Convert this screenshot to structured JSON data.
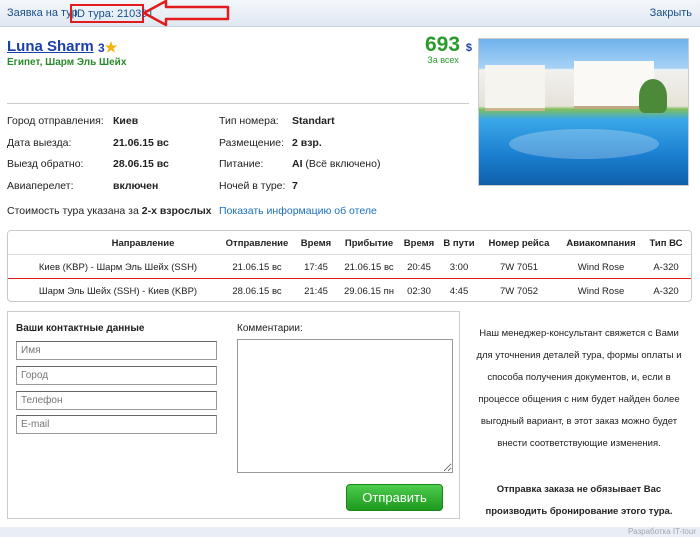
{
  "topbar": {
    "request_label": "Заявка на тур",
    "tour_id_label": "ID тура: 210391",
    "close_label": "Закрыть"
  },
  "hotel": {
    "name": "Luna Sharm",
    "stars": "3",
    "location": "Египет, Шарм Эль Шейх",
    "price": "693",
    "currency": "$",
    "price_note": "За всех",
    "photo_icon": "hotel-photo"
  },
  "details": {
    "departure_city_label": "Город отправления:",
    "departure_city": "Киев",
    "departure_date_label": "Дата выезда:",
    "departure_date": "21.06.15 вс",
    "return_date_label": "Выезд обратно:",
    "return_date": "28.06.15 вс",
    "flight_label": "Авиаперелет:",
    "flight": "включен",
    "room_type_label": "Тип номера:",
    "room_type": "Standart",
    "placement_label": "Размещение:",
    "placement": "2 взр.",
    "meals_label": "Питание:",
    "meals_code": "AI",
    "meals_desc": "(Всё включено)",
    "nights_label": "Ночей в туре:",
    "nights": "7"
  },
  "note": {
    "text": "Стоимость тура указана за",
    "bold": "2-х взрослых",
    "hotel_link": "Показать информацию об отеле"
  },
  "flights": {
    "headers": [
      "Направление",
      "Отправление",
      "Время",
      "Прибытие",
      "Время",
      "В пути",
      "Номер рейса",
      "Авиакомпания",
      "Тип ВС"
    ],
    "rows": [
      [
        "Киев (KBP) - Шарм Эль Шейх (SSH)",
        "21.06.15 вс",
        "17:45",
        "21.06.15 вс",
        "20:45",
        "3:00",
        "7W 7051",
        "Wind Rose",
        "A-320"
      ],
      [
        "Шарм Эль Шейх (SSH) - Киев (KBP)",
        "28.06.15 вс",
        "21:45",
        "29.06.15 пн",
        "02:30",
        "4:45",
        "7W 7052",
        "Wind Rose",
        "A-320"
      ]
    ]
  },
  "contact": {
    "title": "Ваши контактные данные",
    "name_placeholder": "Имя",
    "city_placeholder": "Город",
    "phone_placeholder": "Телефон",
    "email_placeholder": "E-mail",
    "comments_label": "Комментарии:",
    "send_label": "Отправить"
  },
  "manager_text": "Наш менеджер-консультант свяжется с Вами для уточнения деталей тура, формы оплаты и способа получения документов, и, если в процессе общения с ним будет найден более выгодный вариант, в этот заказ можно будет внести соответствующие изменения.",
  "disclaimer": "Отправка заказа не обязывает Вас производить бронирование этого тура.",
  "credit": "Разработка IT-tour"
}
